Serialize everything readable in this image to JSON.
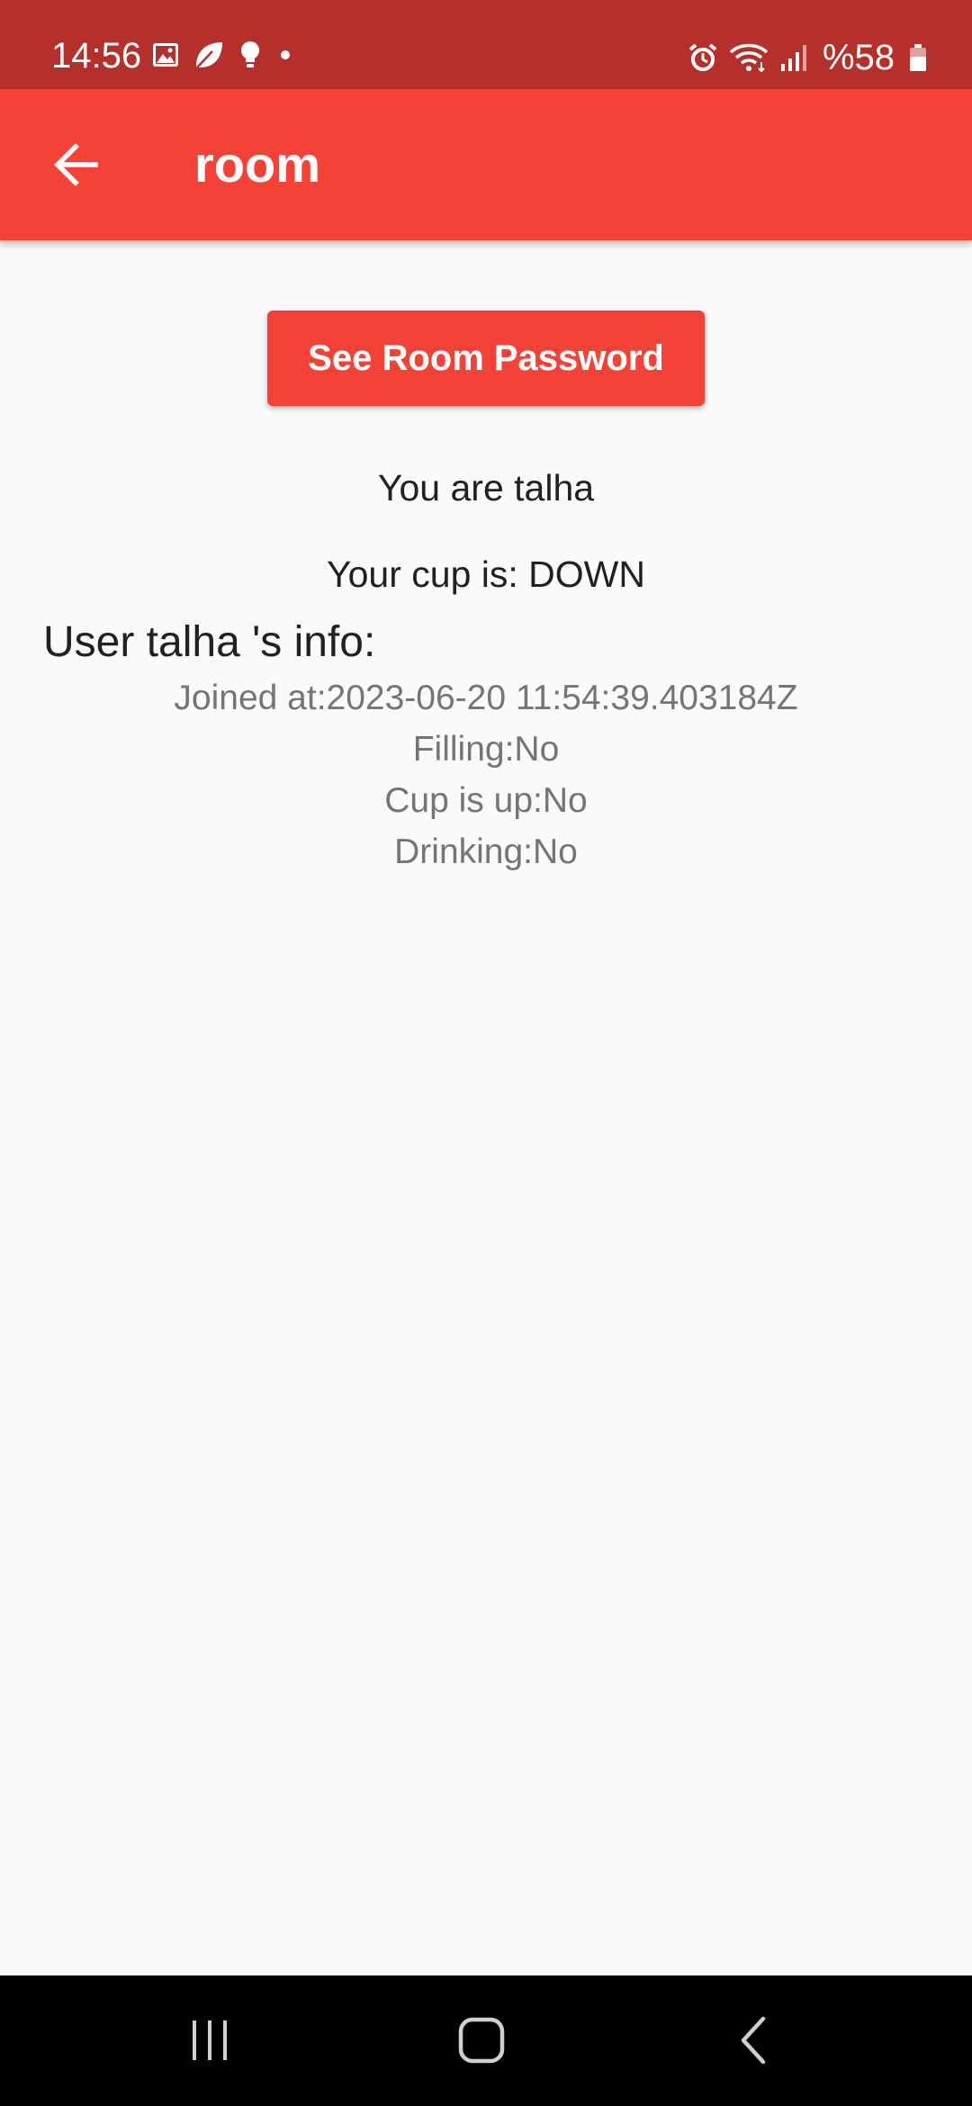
{
  "status_bar": {
    "time": "14:56",
    "battery": "%58",
    "left_icons": [
      "gallery-icon",
      "leaf-icon",
      "bulb-icon",
      "dot-icon"
    ],
    "right_icons": [
      "alarm-icon",
      "wifi-icon",
      "signal-icon",
      "battery-icon"
    ]
  },
  "app_bar": {
    "title": "room",
    "back_icon": "arrow-left-icon",
    "color": "#f44336"
  },
  "content": {
    "password_button_label": "See Room Password",
    "you_are": "You are talha",
    "cup_status": "Your cup is: DOWN",
    "info_heading": "User talha 's info:",
    "info_lines": [
      "Joined at:2023-06-20 11:54:39.403184Z",
      "Filling:No",
      "Cup is up:No",
      "Drinking:No"
    ]
  },
  "nav_bar": {
    "buttons": [
      "recents-icon",
      "home-icon",
      "back-icon"
    ]
  },
  "colors": {
    "status_bar": "#b6302b",
    "accent": "#f44336",
    "background": "#fafafa"
  }
}
